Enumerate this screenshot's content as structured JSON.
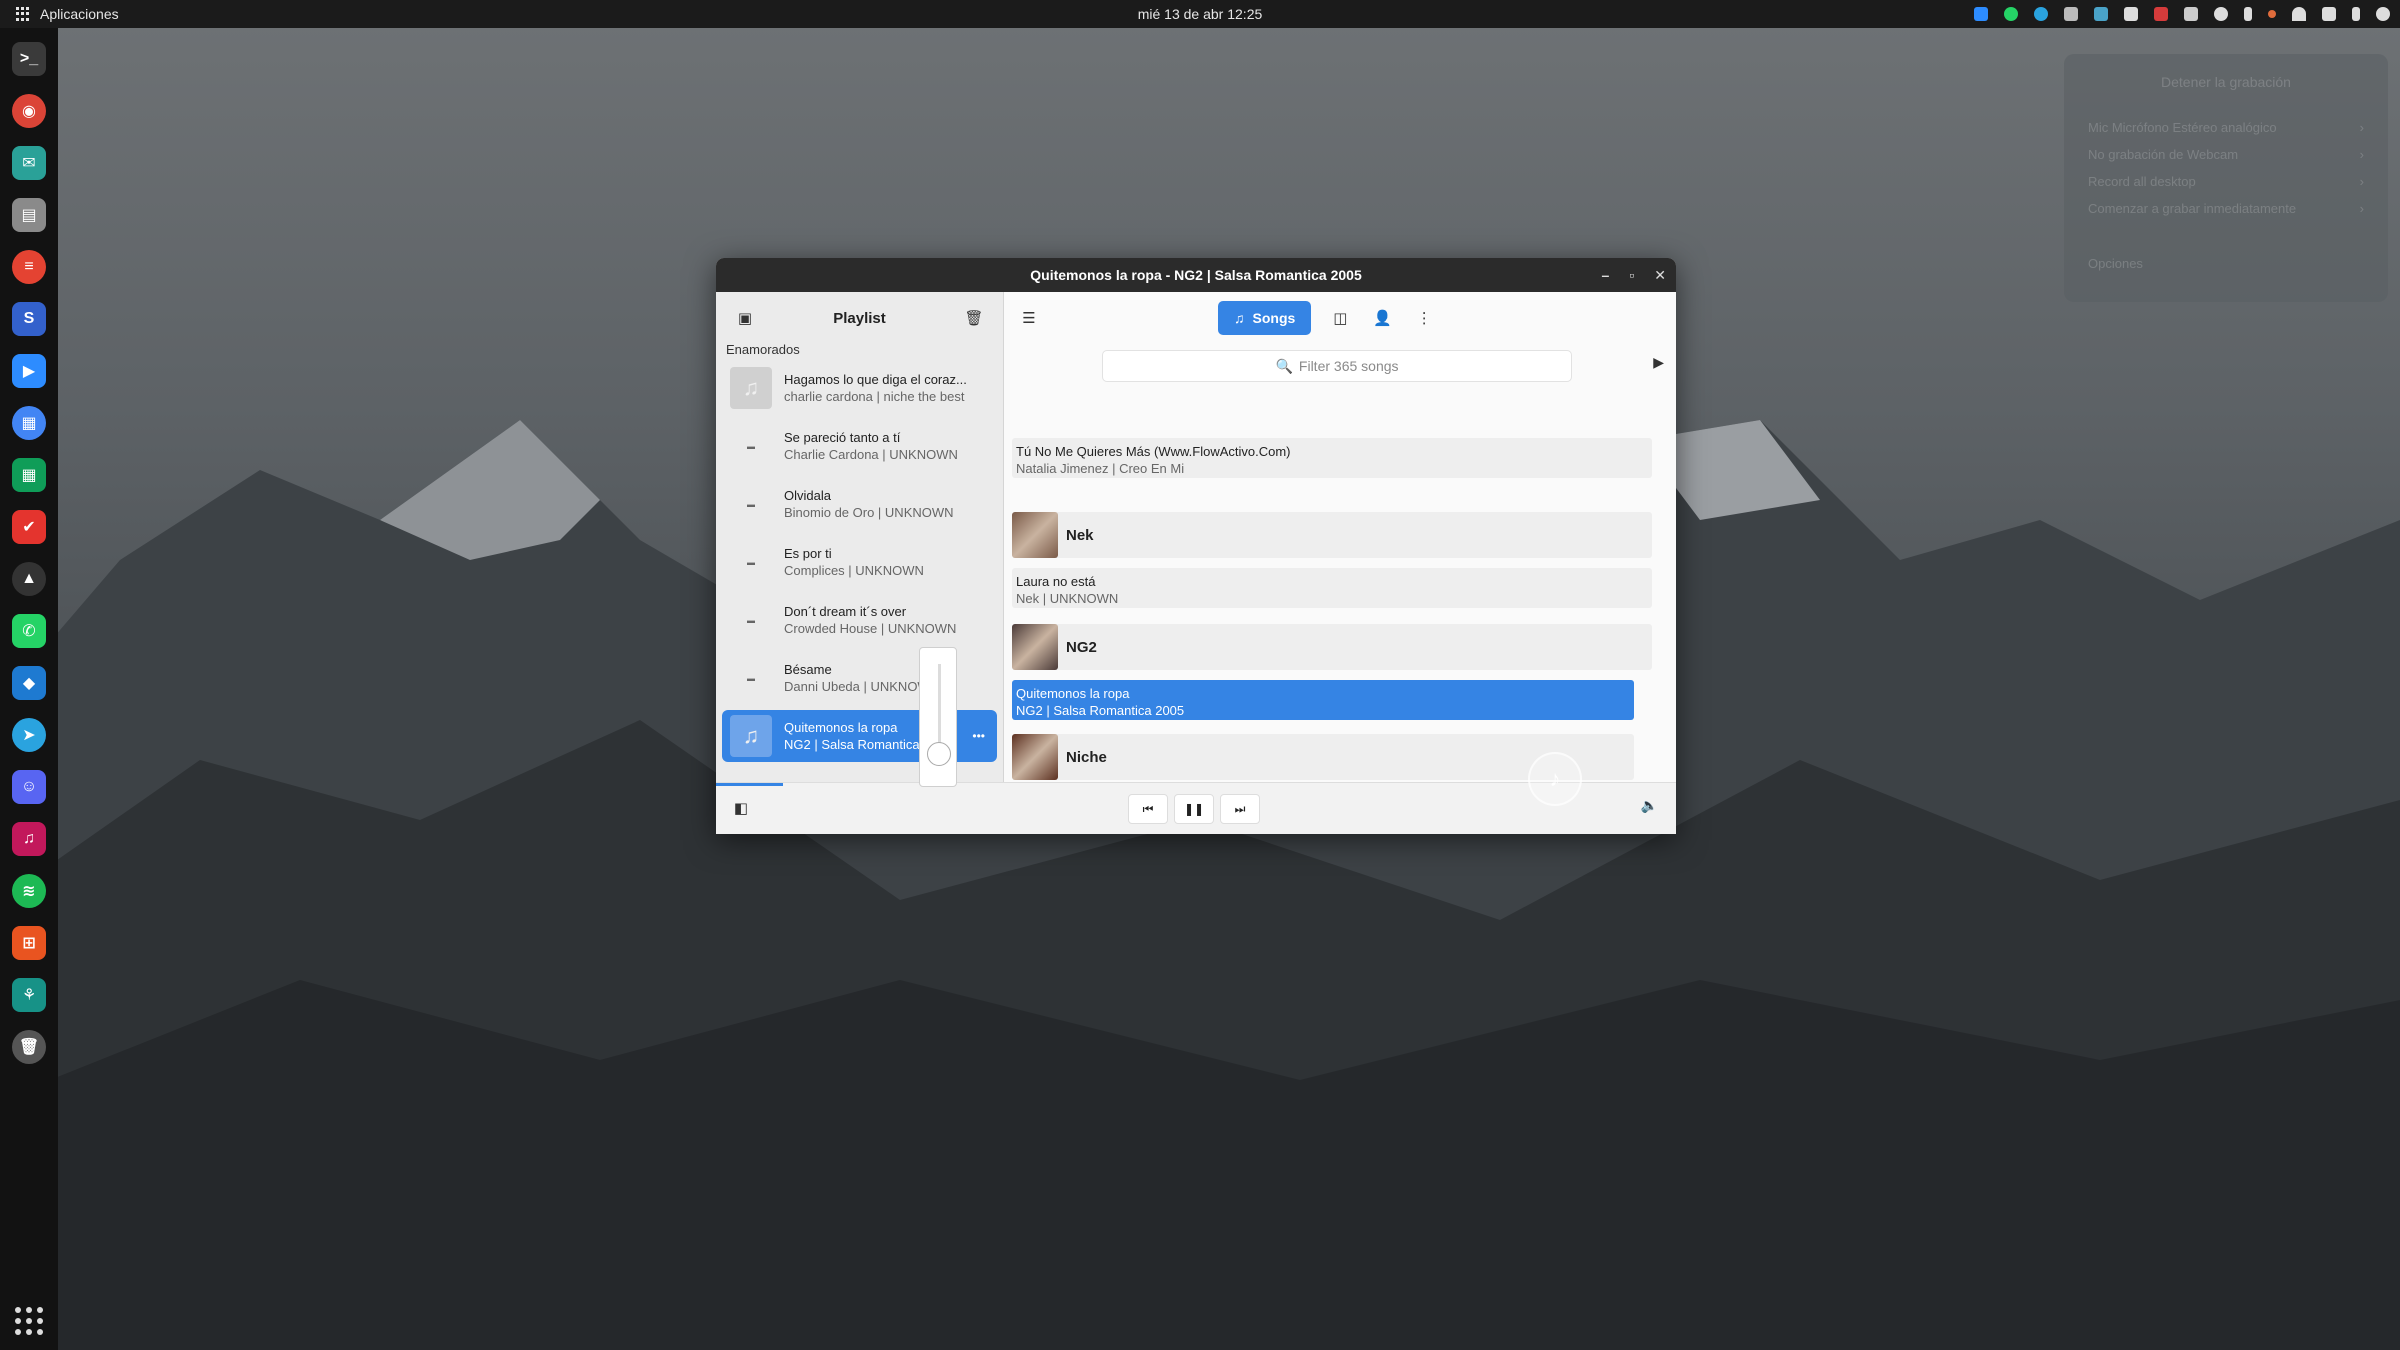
{
  "topbar": {
    "apps_label": "Aplicaciones",
    "clock": "mié 13 de abr  12:25"
  },
  "dock": {
    "apps": [
      {
        "name": "terminal-icon",
        "color": "#3a3a3a",
        "glyph": ">_"
      },
      {
        "name": "chrome-icon",
        "color": "#db4437",
        "glyph": "◉"
      },
      {
        "name": "mail-icon",
        "color": "#2aa198",
        "glyph": "✉"
      },
      {
        "name": "files-icon",
        "color": "#8a8a8a",
        "glyph": "▤"
      },
      {
        "name": "todoist-icon",
        "color": "#e44332",
        "glyph": "≡"
      },
      {
        "name": "simplenote-icon",
        "color": "#3361cc",
        "glyph": "S"
      },
      {
        "name": "zoom-icon",
        "color": "#2d8cff",
        "glyph": "▶"
      },
      {
        "name": "docs-icon",
        "color": "#4285f4",
        "glyph": "▦"
      },
      {
        "name": "sheets-icon",
        "color": "#0f9d58",
        "glyph": "▦"
      },
      {
        "name": "tasks-icon",
        "color": "#e4342e",
        "glyph": "✔"
      },
      {
        "name": "inkscape-icon",
        "color": "#333333",
        "glyph": "▲"
      },
      {
        "name": "whatsapp-icon",
        "color": "#25d366",
        "glyph": "✆"
      },
      {
        "name": "vscode-icon",
        "color": "#1e7ad1",
        "glyph": "◆"
      },
      {
        "name": "telegram-icon",
        "color": "#2aa3df",
        "glyph": "➤"
      },
      {
        "name": "discord-icon",
        "color": "#5865f2",
        "glyph": "☺"
      },
      {
        "name": "music-app-icon",
        "color": "#c2185b",
        "glyph": "♫"
      },
      {
        "name": "spotify-icon",
        "color": "#1db954",
        "glyph": "≋"
      },
      {
        "name": "software-icon",
        "color": "#e95420",
        "glyph": "⊞"
      },
      {
        "name": "gitkraken-icon",
        "color": "#179287",
        "glyph": "⚘"
      },
      {
        "name": "trash-icon",
        "color": "#555555",
        "glyph": "🗑"
      }
    ]
  },
  "rec_menu": {
    "title": "Detener la grabación",
    "items": [
      "Mic Micrófono Estéreo analógico",
      "No grabación de Webcam",
      "Record all desktop",
      "Comenzar a grabar inmediatamente"
    ],
    "options": "Opciones"
  },
  "window": {
    "title": "Quitemonos la ropa - NG2 | Salsa Romantica 2005",
    "controls": [
      "–",
      "▫",
      "✕"
    ]
  },
  "playlist": {
    "title": "Playlist",
    "group": "Enamorados",
    "items": [
      {
        "title": "Hagamos lo que diga el coraz...",
        "subtitle": "charlie cardona | niche the best",
        "has_art": true
      },
      {
        "title": "Se pareció tanto a tí",
        "subtitle": "Charlie Cardona | UNKNOWN",
        "has_art": false
      },
      {
        "title": "Olvidala",
        "subtitle": "Binomio de Oro | UNKNOWN",
        "has_art": false
      },
      {
        "title": "Es por ti",
        "subtitle": "Complices | UNKNOWN",
        "has_art": false
      },
      {
        "title": "Don´t dream it´s over",
        "subtitle": "Crowded House | UNKNOWN",
        "has_art": false
      },
      {
        "title": "Bésame",
        "subtitle": "Danni Ubeda | UNKNOWN",
        "has_art": false
      },
      {
        "title": "Quitemonos la ropa",
        "subtitle": "NG2 | Salsa Romantica ...",
        "has_art": true,
        "active": true
      }
    ]
  },
  "toolbar": {
    "songs_label": "Songs",
    "filter_placeholder": "Filter 365 songs"
  },
  "songlist": {
    "rows": [
      {
        "kind": "song",
        "title": "Tú No Me Quieres Más (Www.FlowActivo.Com)",
        "subtitle": "Natalia Jimenez | Creo En Mi"
      },
      {
        "kind": "artist",
        "name": "Nek",
        "color": "#7a5a48"
      },
      {
        "kind": "song",
        "title": "Laura no está",
        "subtitle": "Nek | UNKNOWN"
      },
      {
        "kind": "artist",
        "name": "NG2",
        "color": "#4a3a38"
      },
      {
        "kind": "song",
        "title": "Quitemonos la ropa",
        "subtitle": "NG2 | Salsa Romantica 2005",
        "selected": true
      },
      {
        "kind": "artist",
        "name": "Niche",
        "color": "#5c3020"
      }
    ]
  },
  "player": {
    "progress": 0.07,
    "volume": 0.1
  }
}
